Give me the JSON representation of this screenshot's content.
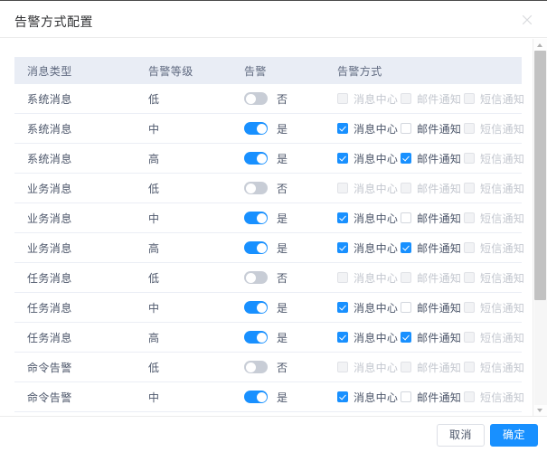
{
  "dialog": {
    "title": "告警方式配置",
    "close_icon": "close-icon"
  },
  "table": {
    "headers": {
      "type": "消息类型",
      "level": "告警等级",
      "alarm": "告警",
      "ways": "告警方式"
    },
    "way_labels": {
      "message_center": "消息中心",
      "email": "邮件通知",
      "sms": "短信通知"
    },
    "switch_labels": {
      "on": "是",
      "off": "否"
    },
    "rows": [
      {
        "type": "系统消息",
        "level": "低",
        "alarm": false,
        "alarm_text": "否",
        "ways": [
          {
            "label": "消息中心",
            "checked": false,
            "disabled": true
          },
          {
            "label": "邮件通知",
            "checked": false,
            "disabled": true
          },
          {
            "label": "短信通知",
            "checked": false,
            "disabled": true
          }
        ]
      },
      {
        "type": "系统消息",
        "level": "中",
        "alarm": true,
        "alarm_text": "是",
        "ways": [
          {
            "label": "消息中心",
            "checked": true,
            "disabled": false
          },
          {
            "label": "邮件通知",
            "checked": false,
            "disabled": false
          },
          {
            "label": "短信通知",
            "checked": false,
            "disabled": true
          }
        ]
      },
      {
        "type": "系统消息",
        "level": "高",
        "alarm": true,
        "alarm_text": "是",
        "ways": [
          {
            "label": "消息中心",
            "checked": true,
            "disabled": false
          },
          {
            "label": "邮件通知",
            "checked": true,
            "disabled": false
          },
          {
            "label": "短信通知",
            "checked": false,
            "disabled": true
          }
        ]
      },
      {
        "type": "业务消息",
        "level": "低",
        "alarm": false,
        "alarm_text": "否",
        "ways": [
          {
            "label": "消息中心",
            "checked": false,
            "disabled": true
          },
          {
            "label": "邮件通知",
            "checked": false,
            "disabled": true
          },
          {
            "label": "短信通知",
            "checked": false,
            "disabled": true
          }
        ]
      },
      {
        "type": "业务消息",
        "level": "中",
        "alarm": true,
        "alarm_text": "是",
        "ways": [
          {
            "label": "消息中心",
            "checked": true,
            "disabled": false
          },
          {
            "label": "邮件通知",
            "checked": false,
            "disabled": false
          },
          {
            "label": "短信通知",
            "checked": false,
            "disabled": true
          }
        ]
      },
      {
        "type": "业务消息",
        "level": "高",
        "alarm": true,
        "alarm_text": "是",
        "ways": [
          {
            "label": "消息中心",
            "checked": true,
            "disabled": false
          },
          {
            "label": "邮件通知",
            "checked": true,
            "disabled": false
          },
          {
            "label": "短信通知",
            "checked": false,
            "disabled": true
          }
        ]
      },
      {
        "type": "任务消息",
        "level": "低",
        "alarm": false,
        "alarm_text": "否",
        "ways": [
          {
            "label": "消息中心",
            "checked": false,
            "disabled": true
          },
          {
            "label": "邮件通知",
            "checked": false,
            "disabled": true
          },
          {
            "label": "短信通知",
            "checked": false,
            "disabled": true
          }
        ]
      },
      {
        "type": "任务消息",
        "level": "中",
        "alarm": true,
        "alarm_text": "是",
        "ways": [
          {
            "label": "消息中心",
            "checked": true,
            "disabled": false
          },
          {
            "label": "邮件通知",
            "checked": false,
            "disabled": false
          },
          {
            "label": "短信通知",
            "checked": false,
            "disabled": true
          }
        ]
      },
      {
        "type": "任务消息",
        "level": "高",
        "alarm": true,
        "alarm_text": "是",
        "ways": [
          {
            "label": "消息中心",
            "checked": true,
            "disabled": false
          },
          {
            "label": "邮件通知",
            "checked": true,
            "disabled": false
          },
          {
            "label": "短信通知",
            "checked": false,
            "disabled": true
          }
        ]
      },
      {
        "type": "命令告警",
        "level": "低",
        "alarm": false,
        "alarm_text": "否",
        "ways": [
          {
            "label": "消息中心",
            "checked": false,
            "disabled": true
          },
          {
            "label": "邮件通知",
            "checked": false,
            "disabled": true
          },
          {
            "label": "短信通知",
            "checked": false,
            "disabled": true
          }
        ]
      },
      {
        "type": "命令告警",
        "level": "中",
        "alarm": true,
        "alarm_text": "是",
        "ways": [
          {
            "label": "消息中心",
            "checked": true,
            "disabled": false
          },
          {
            "label": "邮件通知",
            "checked": false,
            "disabled": false
          },
          {
            "label": "短信通知",
            "checked": false,
            "disabled": true
          }
        ]
      }
    ]
  },
  "footer": {
    "cancel_label": "取消",
    "confirm_label": "确定"
  },
  "scrollbar": {
    "up_icon": "chevron-up-icon",
    "down_icon": "chevron-down-icon"
  },
  "colors": {
    "accent": "#1890ff",
    "header_bg": "#e9edf5",
    "text": "#4c566a",
    "border": "#ebeef5"
  }
}
